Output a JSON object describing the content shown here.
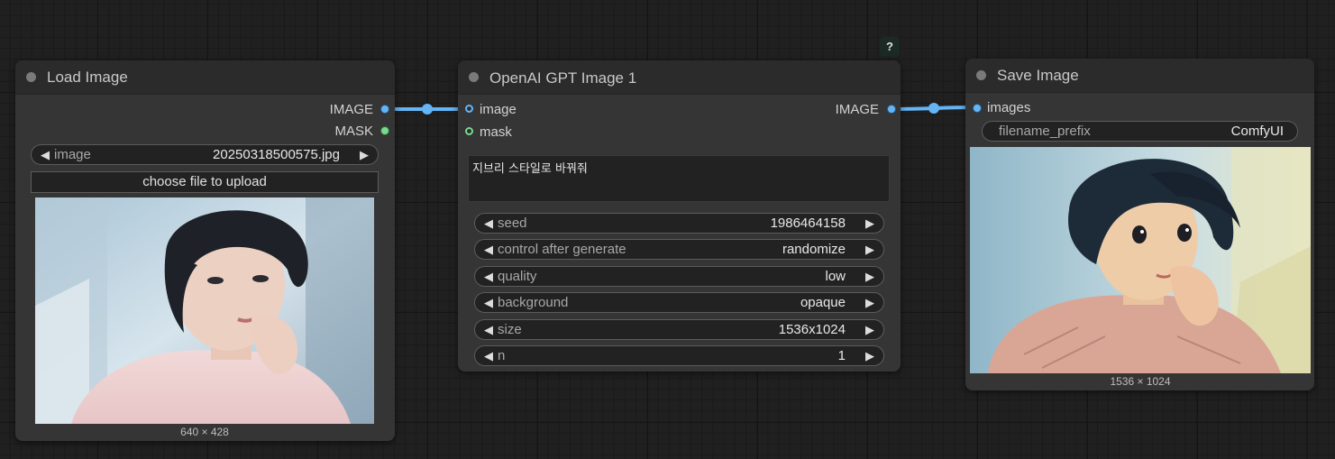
{
  "colors": {
    "link": "#64b5f6",
    "image_socket": "#64b5f6",
    "mask_socket": "#7bd88f",
    "node_body": "#353535",
    "node_header": "#2b2b2b"
  },
  "help_badge": "?",
  "load_image": {
    "title": "Load Image",
    "outputs": [
      "IMAGE",
      "MASK"
    ],
    "image_widget": {
      "label": "image",
      "value": "20250318500575.jpg"
    },
    "upload_label": "choose file to upload",
    "preview_caption": "640 × 428"
  },
  "gpt_image": {
    "title": "OpenAI GPT Image 1",
    "inputs": [
      "image",
      "mask"
    ],
    "output": "IMAGE",
    "prompt": "지브리 스타일로 바꿔줘",
    "widgets": [
      {
        "label": "seed",
        "value": "1986464158"
      },
      {
        "label": "control after generate",
        "value": "randomize"
      },
      {
        "label": "quality",
        "value": "low"
      },
      {
        "label": "background",
        "value": "opaque"
      },
      {
        "label": "size",
        "value": "1536x1024"
      },
      {
        "label": "n",
        "value": "1"
      }
    ]
  },
  "save_image": {
    "title": "Save Image",
    "input": "images",
    "filename_widget": {
      "label": "filename_prefix",
      "value": "ComfyUI"
    },
    "preview_caption": "1536 × 1024"
  }
}
